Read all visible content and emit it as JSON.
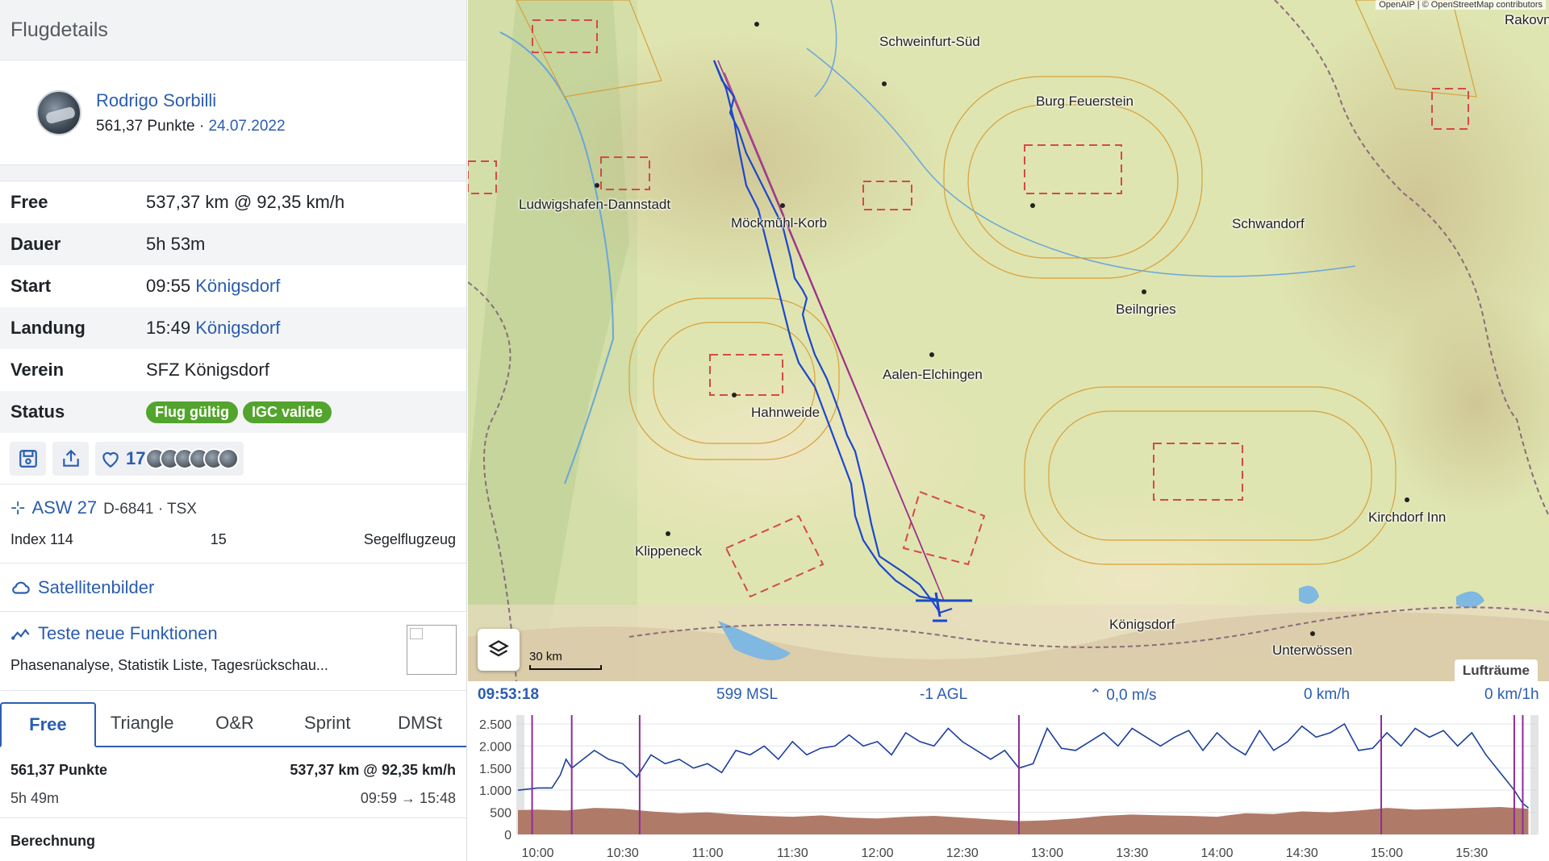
{
  "panel": {
    "title": "Flugdetails",
    "pilot": {
      "name": "Rodrigo Sorbilli",
      "points": "561,37 Punkte",
      "separator": " · ",
      "date": "24.07.2022"
    },
    "details": [
      {
        "key": "Free",
        "value": "537,37 km @ 92,35 km/h"
      },
      {
        "key": "Dauer",
        "value": "5h 53m"
      },
      {
        "key": "Start",
        "time": "09:55",
        "place": "Königsdorf"
      },
      {
        "key": "Landung",
        "time": "15:49",
        "place": "Königsdorf"
      },
      {
        "key": "Verein",
        "club": "SFZ Königsdorf"
      },
      {
        "key": "Status",
        "badges": [
          "Flug gültig",
          "IGC valide"
        ]
      }
    ],
    "likes": "17",
    "aircraft": {
      "type": "ASW 27",
      "registration": "D-6841 · TSX",
      "index": "Index 114",
      "count": "15",
      "category": "Segelflugzeug"
    },
    "satellite": "Satellitenbilder",
    "new_features": {
      "title": "Teste neue Funktionen",
      "desc": "Phasenanalyse, Statistik Liste, Tagesrückschau..."
    },
    "tabs": [
      "Free",
      "Triangle",
      "O&R",
      "Sprint",
      "DMSt"
    ],
    "result": {
      "points": "561,37 Punkte",
      "distance": "537,37 km @ 92,35 km/h",
      "duration": "5h 49m",
      "times": "09:59 → 15:48"
    },
    "calc": "Berechnung"
  },
  "map": {
    "attribution": "OpenAIP | © OpenStreetMap contributors",
    "places": [
      "Schweinfurt-Süd",
      "Burg Feuerstein",
      "Ludwigshafen-Dannstadt",
      "Möckmühl-Korb",
      "Schwandorf",
      "Beilngries",
      "Aalen-Elchingen",
      "Hahnweide",
      "Kirchdorf Inn",
      "Klippeneck",
      "Königsdorf",
      "Unterwössen",
      "Rakovni"
    ],
    "scale": "30 km",
    "airspace_tab": "Lufträume"
  },
  "barogram": {
    "readout": {
      "time": "09:53:18",
      "msl": "599 MSL",
      "agl": "-1 AGL",
      "vario": "0,0 m/s",
      "speed": "0 km/h",
      "wind": "0 km/1h"
    },
    "y_ticks": [
      "2.500",
      "2.000",
      "1.500",
      "1.000",
      "500",
      "0"
    ],
    "x_ticks": [
      "10:00",
      "10:30",
      "11:00",
      "11:30",
      "12:00",
      "12:30",
      "13:00",
      "13:30",
      "14:00",
      "14:30",
      "15:00",
      "15:30"
    ]
  },
  "chart_data": {
    "type": "line",
    "ylim": [
      0,
      2700
    ],
    "xlim": [
      "09:53",
      "15:53"
    ],
    "series": [
      {
        "x": [
          "09:53",
          "10:00",
          "10:05",
          "10:08",
          "10:10",
          "10:12",
          "10:15",
          "10:20",
          "10:25",
          "10:30",
          "10:35",
          "10:40",
          "10:45",
          "10:50",
          "10:55",
          "11:00",
          "11:05",
          "11:10",
          "11:15",
          "11:20",
          "11:25",
          "11:30",
          "11:35",
          "11:40",
          "11:45",
          "11:50",
          "11:55",
          "12:00",
          "12:05",
          "12:10",
          "12:15",
          "12:20",
          "12:25",
          "12:30",
          "12:35",
          "12:40",
          "12:45",
          "12:50",
          "12:55",
          "13:00",
          "13:05",
          "13:10",
          "13:15",
          "13:20",
          "13:25",
          "13:30",
          "13:35",
          "13:40",
          "13:45",
          "13:50",
          "13:55",
          "14:00",
          "14:05",
          "14:10",
          "14:15",
          "14:20",
          "14:25",
          "14:30",
          "14:35",
          "14:40",
          "14:45",
          "14:50",
          "14:55",
          "15:00",
          "15:05",
          "15:10",
          "15:15",
          "15:20",
          "15:25",
          "15:30",
          "15:35",
          "15:40",
          "15:45",
          "15:48",
          "15:50"
        ],
        "values": [
          1000,
          1050,
          1050,
          1350,
          1700,
          1500,
          1650,
          1900,
          1700,
          1600,
          1300,
          1800,
          1600,
          1700,
          1500,
          1600,
          1400,
          1900,
          1800,
          2000,
          1700,
          2100,
          1800,
          1950,
          2000,
          2250,
          2000,
          2100,
          1800,
          2300,
          2100,
          2000,
          2400,
          2100,
          1900,
          1700,
          1900,
          1500,
          1600,
          2400,
          1950,
          1900,
          2100,
          2300,
          2000,
          2400,
          2200,
          2000,
          2200,
          2350,
          1900,
          2300,
          2000,
          1800,
          2350,
          1900,
          2100,
          2450,
          2200,
          2300,
          2500,
          1900,
          1950,
          2300,
          2000,
          2400,
          2200,
          2350,
          2000,
          2300,
          1800,
          1400,
          1000,
          700,
          600
        ]
      },
      {
        "x": [
          "09:53",
          "10:00",
          "10:10",
          "10:20",
          "10:30",
          "10:40",
          "10:50",
          "11:00",
          "11:10",
          "11:20",
          "11:30",
          "11:40",
          "11:50",
          "12:00",
          "12:10",
          "12:20",
          "12:30",
          "12:40",
          "12:50",
          "13:00",
          "13:10",
          "13:20",
          "13:30",
          "13:40",
          "13:50",
          "14:00",
          "14:10",
          "14:20",
          "14:30",
          "14:40",
          "14:50",
          "15:00",
          "15:10",
          "15:20",
          "15:30",
          "15:40",
          "15:50"
        ],
        "values": [
          550,
          560,
          540,
          600,
          580,
          520,
          480,
          500,
          450,
          420,
          400,
          430,
          380,
          360,
          400,
          420,
          380,
          340,
          300,
          320,
          360,
          420,
          450,
          430,
          420,
          400,
          480,
          460,
          520,
          500,
          540,
          600,
          560,
          580,
          600,
          620,
          580
        ]
      }
    ]
  }
}
